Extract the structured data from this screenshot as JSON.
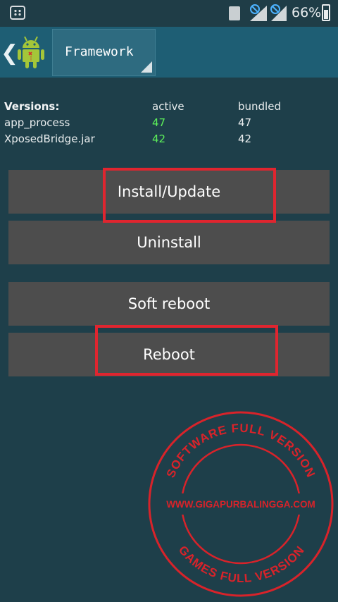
{
  "status_bar": {
    "battery_percent": "66%",
    "icons": [
      "bbm-icon",
      "sd-card-icon",
      "no-signal-icon",
      "signal-icon",
      "no-signal-icon",
      "signal-icon",
      "battery-icon"
    ]
  },
  "action_bar": {
    "spinner_label": "Framework",
    "icons": {
      "back": "chevron-left-icon",
      "app": "android-robot-icon"
    }
  },
  "versions": {
    "header": {
      "label": "Versions:",
      "active": "active",
      "bundled": "bundled"
    },
    "rows": [
      {
        "name": "app_process",
        "active": "47",
        "bundled": "47"
      },
      {
        "name": "XposedBridge.jar",
        "active": "42",
        "bundled": "42"
      }
    ]
  },
  "buttons": {
    "install_update": "Install/Update",
    "uninstall": "Uninstall",
    "soft_reboot": "Soft reboot",
    "reboot": "Reboot"
  },
  "watermark": {
    "top_text": "SOFTWARE FULL VERSION",
    "middle_text": "WWW.GIGAPURBALINGGA.COM",
    "bottom_text": "GAMES FULL VERSION"
  },
  "colors": {
    "background": "#1e3f4a",
    "action_bar": "#1e5e74",
    "button": "#4d4d4d",
    "active_version": "#5df05a",
    "highlight": "#e0252f"
  }
}
